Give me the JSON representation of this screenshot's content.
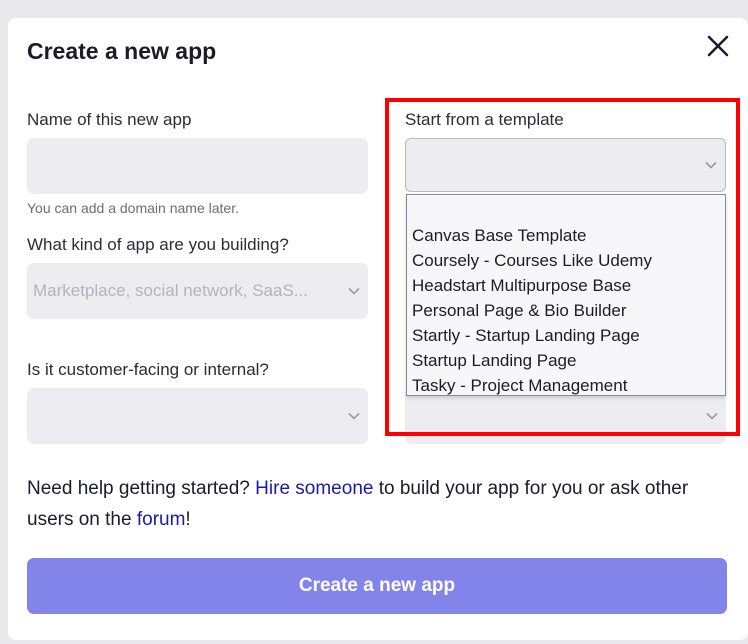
{
  "modal": {
    "title": "Create a new app",
    "close_icon": "close-icon"
  },
  "name_field": {
    "label": "Name of this new app",
    "value": "",
    "hint": "You can add a domain name later."
  },
  "kind_field": {
    "label": "What kind of app are you building?",
    "placeholder": "Marketplace, social network, SaaS..."
  },
  "audience_field": {
    "label": "Is it customer-facing or internal?",
    "value": ""
  },
  "template_field": {
    "label": "Start from a template",
    "value": "",
    "options": [
      "Canvas Base Template",
      "Coursely - Courses Like Udemy",
      "Headstart Multipurpose Base",
      "Personal Page & Bio Builder",
      "Startly - Startup Landing Page",
      "Startup Landing Page",
      "Tasky - Project Management"
    ]
  },
  "help": {
    "prefix": "Need help getting started? ",
    "hire_link": "Hire someone",
    "middle": " to build your app for you or ask other users on the ",
    "forum_link": "forum",
    "suffix": "!"
  },
  "create_button": {
    "label": "Create a new app"
  },
  "colors": {
    "accent": "#8384ea",
    "link": "#1a1aa8",
    "highlight_box": "#ff0000",
    "field_bg": "#ededf1"
  }
}
